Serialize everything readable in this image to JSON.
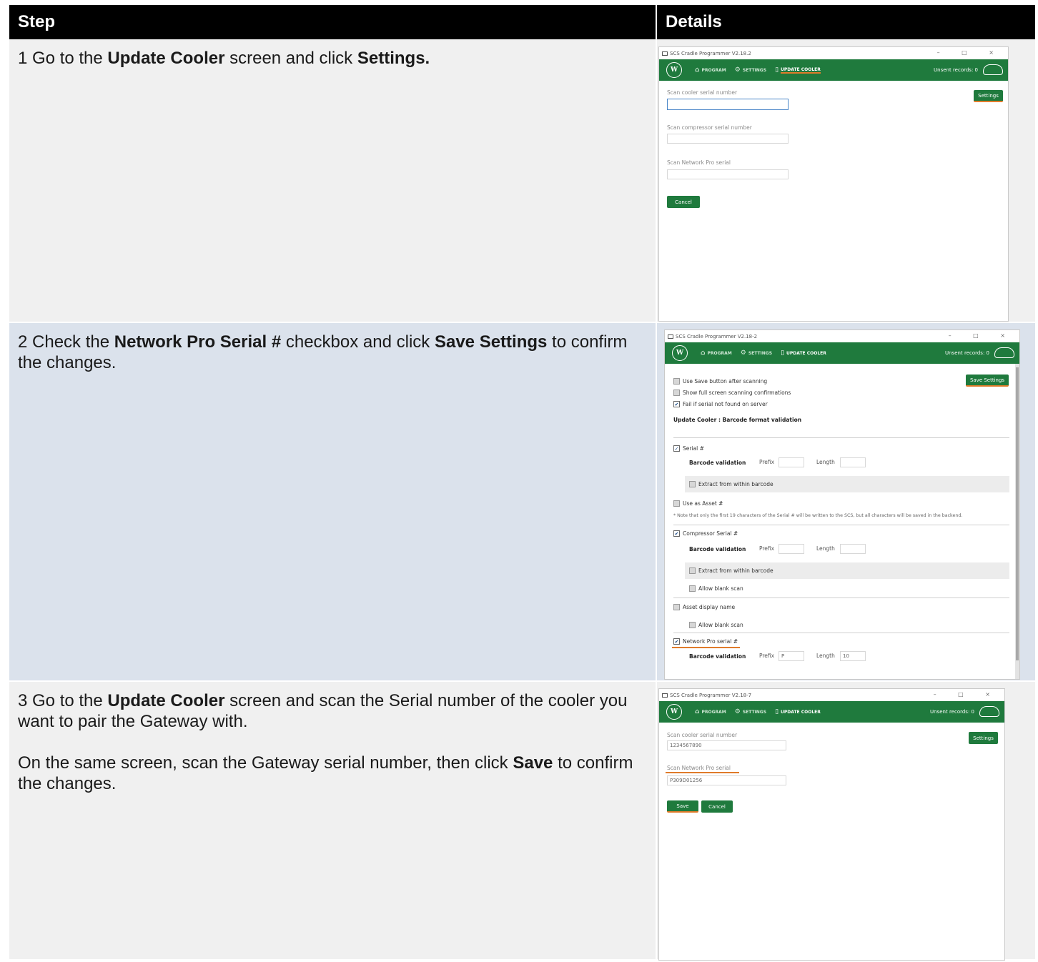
{
  "table": {
    "headers": [
      "Step",
      "Details"
    ]
  },
  "steps": [
    {
      "text": [
        {
          "t": "1 Go to the ",
          "b": false
        },
        {
          "t": "Update Cooler",
          "b": true
        },
        {
          "t": " screen and click ",
          "b": false
        },
        {
          "t": "Settings.",
          "b": true
        }
      ]
    },
    {
      "text": [
        {
          "t": "2 Check the ",
          "b": false
        },
        {
          "t": "Network Pro Serial #",
          "b": true
        },
        {
          "t": " checkbox and click ",
          "b": false
        },
        {
          "t": "Save Settings",
          "b": true
        },
        {
          "t": " to confirm the changes.",
          "b": false
        }
      ]
    },
    {
      "para1": [
        {
          "t": "3 Go to the ",
          "b": false
        },
        {
          "t": "Update Cooler",
          "b": true
        },
        {
          "t": " screen and scan the Serial number of the cooler you want to pair the Gateway with.",
          "b": false
        }
      ],
      "para2": [
        {
          "t": "On the same screen, scan the Gateway serial number, then click ",
          "b": false
        },
        {
          "t": "Save",
          "b": true
        },
        {
          "t": " to confirm the changes.",
          "b": false
        }
      ]
    }
  ],
  "screens": {
    "s1": {
      "title": "SCS Cradle Programmer V2.18.2",
      "controls": "– □ ×",
      "logo": "W",
      "nav": [
        "PROGRAM",
        "SETTINGS",
        "UPDATE COOLER"
      ],
      "unsent": "Unsent records: 0",
      "fields": [
        "Scan cooler serial number",
        "Scan compressor serial number",
        "Scan Network Pro serial"
      ],
      "settings_btn": "Settings",
      "cancel_btn": "Cancel"
    },
    "s2": {
      "title": "SCS Cradle Programmer V2.18-2",
      "controls": "– □ ×",
      "logo": "W",
      "nav": [
        "PROGRAM",
        "SETTINGS",
        "UPDATE COOLER"
      ],
      "unsent": "Unsent records: 0",
      "save_settings_btn": "Save Settings",
      "options": [
        "Use Save button after scanning",
        "Show full screen scanning confirmations",
        "Fail if serial not found on server"
      ],
      "section_title": "Update Cooler : Barcode format validation",
      "serial": "Serial #",
      "barcode_validation": "Barcode validation",
      "prefix": "Prefix",
      "length": "Length",
      "extract": "Extract from within barcode",
      "use_asset": "Use as Asset #",
      "note": "* Note that only the first 19 characters of the Serial # will be written to the SCS, but all characters will be saved in the backend.",
      "compressor": "Compressor Serial #",
      "allow_blank": "Allow blank scan",
      "asset_display": "Asset display name",
      "network_pro": "Network Pro serial #",
      "np_prefix_value": "P",
      "np_length_value": "10"
    },
    "s3": {
      "title": "SCS Cradle Programmer V2.18-7",
      "controls": "– □ ×",
      "logo": "W",
      "nav": [
        "PROGRAM",
        "SETTINGS",
        "UPDATE COOLER"
      ],
      "unsent": "Unsent records: 0",
      "settings_btn": "Settings",
      "field1_label": "Scan cooler serial number",
      "field1_value": "1234567890",
      "field2_label": "Scan Network Pro serial",
      "field2_value": "P309D01256",
      "save_btn": "Save",
      "cancel_btn": "Cancel"
    }
  },
  "colors": {
    "header_bg": "#000000",
    "row_gray": "#f0f0f0",
    "row_blue": "#dbe2ec",
    "app_green": "#1f7a3d",
    "highlight_orange": "#e07b2a"
  }
}
